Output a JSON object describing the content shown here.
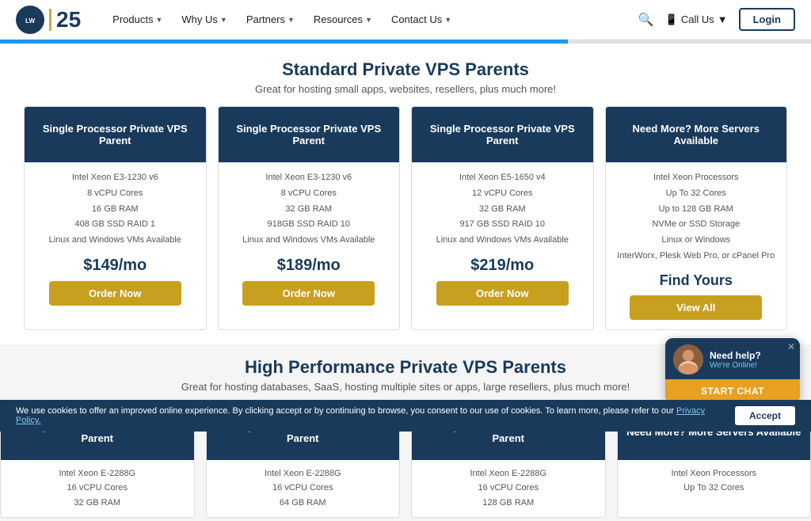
{
  "navbar": {
    "logo_text": "25",
    "liquid_web_label": "Liquid Web",
    "nav_items": [
      {
        "label": "Products",
        "id": "products"
      },
      {
        "label": "Why Us",
        "id": "why-us"
      },
      {
        "label": "Partners",
        "id": "partners"
      },
      {
        "label": "Resources",
        "id": "resources"
      },
      {
        "label": "Contact Us",
        "id": "contact-us"
      }
    ],
    "call_us_label": "Call Us",
    "login_label": "Login"
  },
  "standard_section": {
    "title": "Standard Private VPS Parents",
    "subtitle": "Great for hosting small apps, websites, resellers, plus much more!"
  },
  "cards": [
    {
      "header": "Single Processor Private VPS Parent",
      "specs": [
        "Intel Xeon E3-1230 v6",
        "8 vCPU Cores",
        "16 GB RAM",
        "408 GB SSD RAID 1",
        "Linux and Windows VMs Available"
      ],
      "price": "$149/mo",
      "btn_label": "Order Now"
    },
    {
      "header": "Single Processor Private VPS Parent",
      "specs": [
        "Intel Xeon E3-1230 v6",
        "8 vCPU Cores",
        "32 GB RAM",
        "918GB SSD RAID 10",
        "Linux and Windows VMs Available"
      ],
      "price": "$189/mo",
      "btn_label": "Order Now"
    },
    {
      "header": "Single Processor Private VPS Parent",
      "specs": [
        "Intel Xeon E5-1650 v4",
        "12 vCPU Cores",
        "32 GB RAM",
        "917 GB SSD RAID 10",
        "Linux and Windows VMs Available"
      ],
      "price": "$219/mo",
      "btn_label": "Order Now"
    },
    {
      "header": "Need More? More Servers Available",
      "specs": [
        "Intel Xeon Processors",
        "Up To 32 Cores",
        "Up to 128 GB RAM",
        "NVMe or SSD Storage",
        "Linux or Windows",
        "InterWorx, Plesk Web Pro, or cPanel Pro"
      ],
      "find_yours": "Find Yours",
      "btn_label": "View All"
    }
  ],
  "hp_section": {
    "title": "High Performance Private VPS Parents",
    "subtitle": "Great for hosting databases, SaaS, hosting multiple sites or apps, large resellers, plus much more!"
  },
  "hp_cards": [
    {
      "header": "Single Processor Private VPS Parent",
      "specs": [
        "Intel Xeon E-2288G",
        "16 vCPU Cores",
        "32 GB RAM"
      ]
    },
    {
      "header": "Single Processor Private VPS Parent",
      "specs": [
        "Intel Xeon E-2288G",
        "16 vCPU Cores",
        "64 GB RAM"
      ]
    },
    {
      "header": "Single Processor Private VPS Parent",
      "specs": [
        "Intel Xeon E-2288G",
        "16 vCPU Cores",
        "128 GB RAM"
      ]
    },
    {
      "header": "Need More? More Servers Available",
      "specs": [
        "Intel Xeon Processors",
        "Up To 32 Cores"
      ]
    }
  ],
  "chat_widget": {
    "title": "Need help?",
    "subtitle": "We're Online!",
    "cta": "START CHAT",
    "close": "✕"
  },
  "cookie_bar": {
    "text": "We use cookies to offer an improved online experience. By clicking accept or by continuing to browse, you consent to our use of cookies. To learn more, please refer to our ",
    "link_text": "Privacy Policy.",
    "accept_label": "Accept"
  },
  "progress": {
    "fill_percent": 70
  }
}
